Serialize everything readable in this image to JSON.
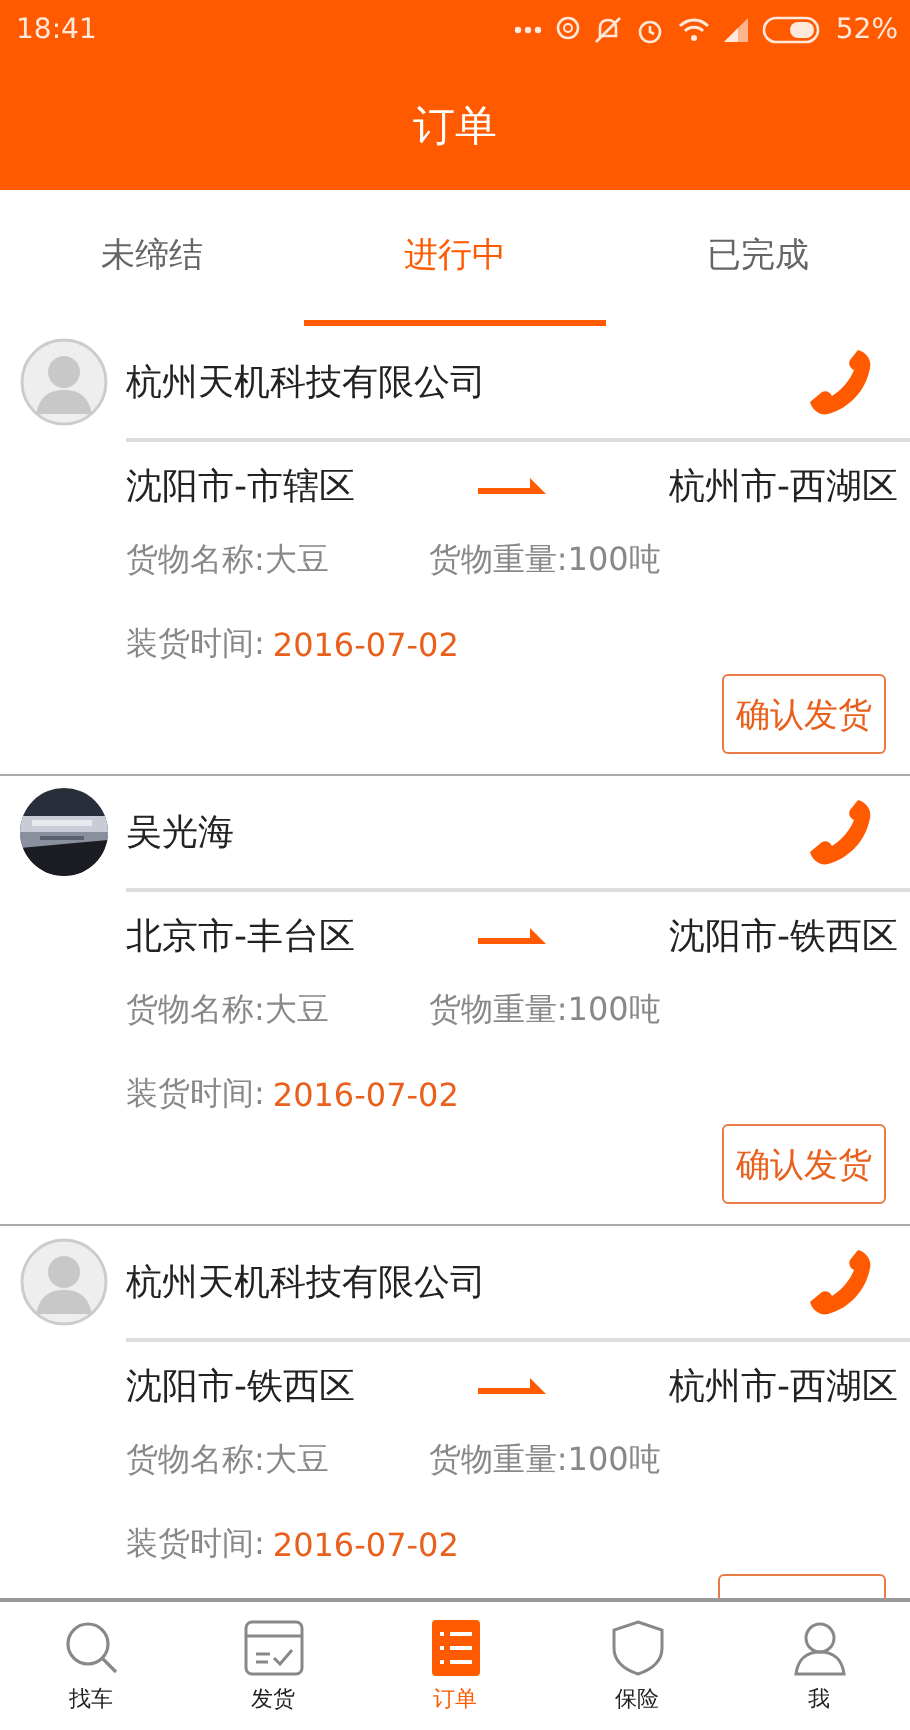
{
  "status_bar": {
    "time": "18:41",
    "battery": "52%"
  },
  "title": "订单",
  "tabs": [
    {
      "label": "未缔结",
      "selected": false
    },
    {
      "label": "进行中",
      "selected": true
    },
    {
      "label": "已完成",
      "selected": false
    }
  ],
  "orders": [
    {
      "avatar": {
        "kind": "placeholder"
      },
      "name": "杭州天机科技有限公司",
      "from": "沈阳市-市辖区",
      "to": "杭州市-西湖区",
      "cargo_name": "货物名称:大豆",
      "cargo_weight": "货物重量:100吨",
      "load_label": "装货时间:",
      "load_date": "2016-07-02",
      "action": {
        "label": "确认发货"
      }
    },
    {
      "name": "吴光海",
      "from": "北京市-丰台区",
      "to": "沈阳市-铁西区",
      "cargo_name": "货物名称:大豆",
      "cargo_weight": "货物重量:100吨",
      "load_label": "装货时间:",
      "load_date": "2016-07-02",
      "action": {
        "label": "确认发货"
      }
    },
    {
      "avatar": {
        "kind": "placeholder"
      },
      "name": "杭州天机科技有限公司",
      "from": "沈阳市-铁西区",
      "to": "杭州市-西湖区",
      "cargo_name": "货物名称:大豆",
      "cargo_weight": "货物重量:100吨",
      "load_label": "装货时间:",
      "load_date": "2016-07-02",
      "action": {
        "clipped": true
      }
    }
  ],
  "nav": [
    {
      "label": "找车",
      "selected": false
    },
    {
      "label": "发货",
      "selected": false
    },
    {
      "label": "订单",
      "selected": true
    },
    {
      "label": "保险",
      "selected": false
    },
    {
      "label": "我",
      "selected": false
    }
  ]
}
